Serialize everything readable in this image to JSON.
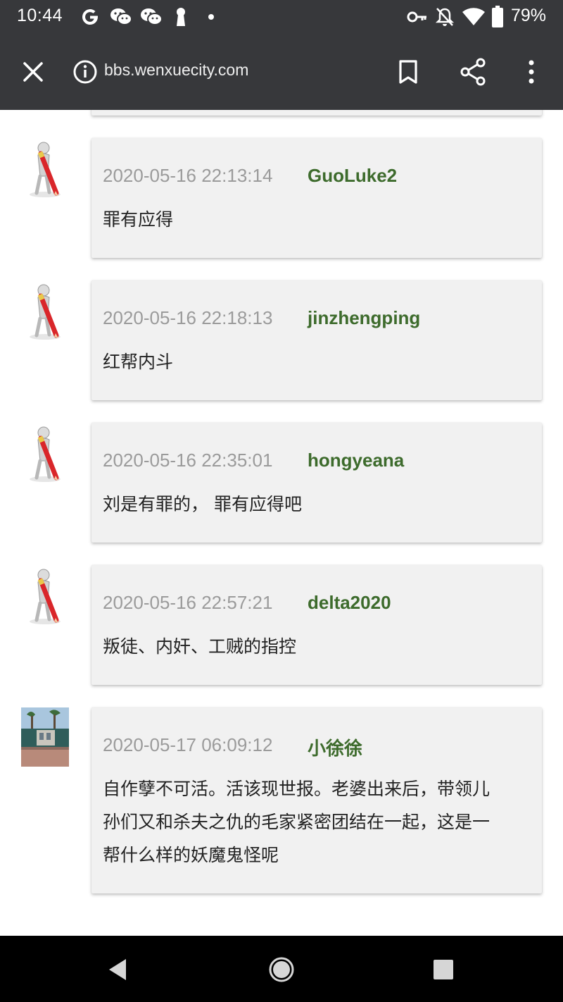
{
  "status_bar": {
    "time": "10:44",
    "battery": "79%",
    "left_icons": [
      "google-icon",
      "wechat-icon",
      "wechat-icon",
      "keyhole-icon",
      "dot-icon"
    ],
    "right_icons": [
      "key-icon",
      "bell-off-icon",
      "wifi-icon",
      "battery-icon"
    ]
  },
  "toolbar": {
    "url": "bbs.wenxuecity.com",
    "icons": [
      "close-icon",
      "info-icon",
      "bookmark-icon",
      "share-icon",
      "more-icon"
    ]
  },
  "comments": [
    {
      "timestamp": "2020-05-16 22:13:14",
      "user": "GuoLuke2",
      "text": "罪有应得",
      "avatar": "pencil-figure"
    },
    {
      "timestamp": "2020-05-16 22:18:13",
      "user": "jinzhengping",
      "text": "红帮内斗",
      "avatar": "pencil-figure"
    },
    {
      "timestamp": "2020-05-16 22:35:01",
      "user": "hongyeana",
      "text": "刘是有罪的， 罪有应得吧",
      "avatar": "pencil-figure"
    },
    {
      "timestamp": "2020-05-16 22:57:21",
      "user": "delta2020",
      "text": "叛徒、内奸、工贼的指控",
      "avatar": "pencil-figure"
    },
    {
      "timestamp": "2020-05-17 06:09:12",
      "user": "小徐徐",
      "text_lines": [
        "自作孽不可活。活该现世报。老婆出来后，带领儿",
        "孙们又和杀夫之仇的毛家紧密团结在一起，这是一",
        "帮什么样的妖魔鬼怪呢"
      ],
      "avatar": "photo"
    }
  ],
  "nav_bar": {
    "buttons": [
      "back-icon",
      "home-icon",
      "recents-icon"
    ]
  },
  "colors": {
    "toolbar": "#37383b",
    "username": "#3d6b2c",
    "timestamp": "#9b9b9b",
    "card": "#f1f1f1"
  }
}
